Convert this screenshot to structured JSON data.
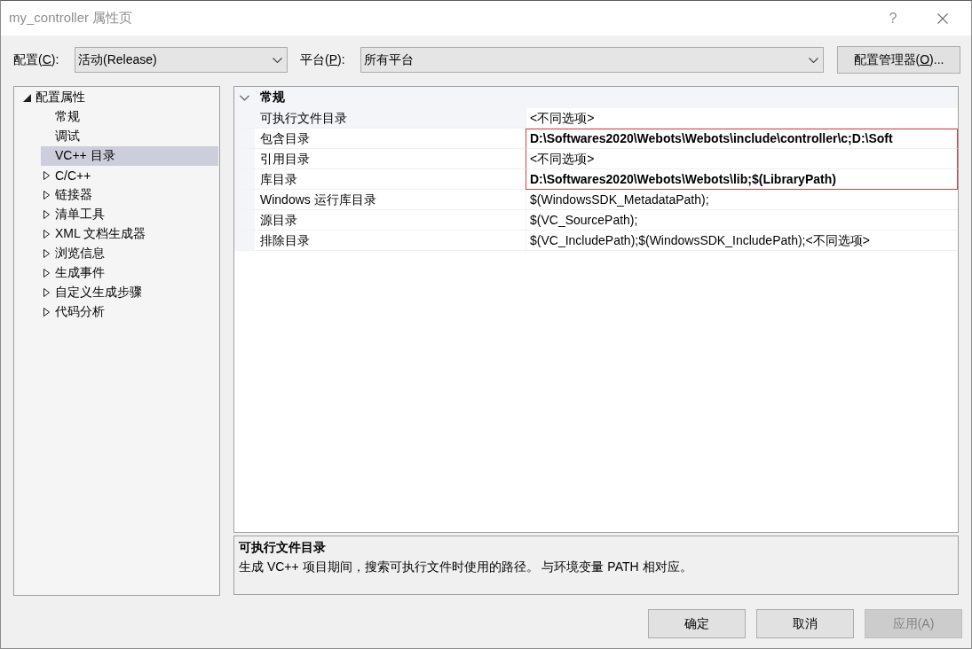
{
  "window": {
    "title": "my_controller 属性页",
    "help_button": "?"
  },
  "config_bar": {
    "configuration": {
      "label": {
        "before": "配置(",
        "access_key": "C",
        "after": "):"
      },
      "value": "活动(Release)"
    },
    "platform": {
      "label": {
        "before": "平台(",
        "access_key": "P",
        "after": "):"
      },
      "value": "所有平台"
    },
    "manager_button": {
      "before": "配置管理器(",
      "access_key": "O",
      "after": ")..."
    }
  },
  "tree": {
    "items": [
      {
        "label": "配置属性",
        "kind": "group",
        "expanded": true,
        "selected": false,
        "children": [
          {
            "label": "常规",
            "kind": "page",
            "selected": false
          },
          {
            "label": "调试",
            "kind": "page",
            "selected": false
          },
          {
            "label": "VC++ 目录",
            "kind": "page",
            "selected": true
          },
          {
            "label": "C/C++",
            "kind": "group",
            "expanded": false,
            "selected": false
          },
          {
            "label": "链接器",
            "kind": "group",
            "expanded": false,
            "selected": false
          },
          {
            "label": "清单工具",
            "kind": "group",
            "expanded": false,
            "selected": false
          },
          {
            "label": "XML 文档生成器",
            "kind": "group",
            "expanded": false,
            "selected": false
          },
          {
            "label": "浏览信息",
            "kind": "group",
            "expanded": false,
            "selected": false
          },
          {
            "label": "生成事件",
            "kind": "group",
            "expanded": false,
            "selected": false
          },
          {
            "label": "自定义生成步骤",
            "kind": "group",
            "expanded": false,
            "selected": false
          },
          {
            "label": "代码分析",
            "kind": "group",
            "expanded": false,
            "selected": false
          }
        ]
      }
    ]
  },
  "property_grid": {
    "categories": [
      {
        "label": "常规",
        "expanded": true,
        "rows": [
          {
            "name": "可执行文件目录",
            "value": "<不同选项>",
            "modified": false,
            "selected": true,
            "highlighted": false
          },
          {
            "name": "包含目录",
            "value": "D:\\Softwares2020\\Webots\\Webots\\include\\controller\\c;D:\\Soft",
            "modified": true,
            "selected": false,
            "highlighted": true
          },
          {
            "name": "引用目录",
            "value": "<不同选项>",
            "modified": false,
            "selected": false,
            "highlighted": true
          },
          {
            "name": "库目录",
            "value": "D:\\Softwares2020\\Webots\\Webots\\lib;$(LibraryPath)",
            "modified": true,
            "selected": false,
            "highlighted": true
          },
          {
            "name": "Windows 运行库目录",
            "value": "$(WindowsSDK_MetadataPath);",
            "modified": false,
            "selected": false,
            "highlighted": false
          },
          {
            "name": "源目录",
            "value": "$(VC_SourcePath);",
            "modified": false,
            "selected": false,
            "highlighted": false
          },
          {
            "name": "排除目录",
            "value": "$(VC_IncludePath);$(WindowsSDK_IncludePath);<不同选项>",
            "modified": false,
            "selected": false,
            "highlighted": false
          }
        ]
      }
    ]
  },
  "description": {
    "title": "可执行文件目录",
    "text": "生成 VC++ 项目期间，搜索可执行文件时使用的路径。 与环境变量 PATH 相对应。"
  },
  "buttons": [
    {
      "label": "确定",
      "disabled": false
    },
    {
      "label": "取消",
      "disabled": false
    },
    {
      "label": "应用(A)",
      "disabled": true
    }
  ]
}
